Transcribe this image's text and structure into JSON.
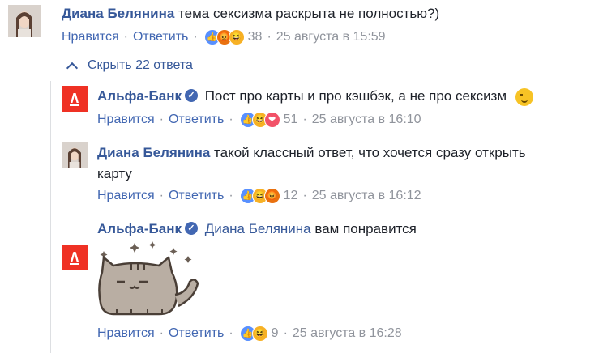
{
  "colors": {
    "link": "#365899",
    "action": "#4267b2",
    "meta": "#90949c",
    "alfa_red": "#ef3124"
  },
  "toggle": {
    "label": "Скрыть 22 ответа",
    "icon": "chevron-up-icon"
  },
  "actions": {
    "like": "Нравится",
    "reply": "Ответить",
    "separator": "·"
  },
  "comments": [
    {
      "author": "Диана Белянина",
      "text": "тема сексизма раскрыта не полностью?)",
      "reactions": [
        "like",
        "laugh",
        "laugh"
      ],
      "reaction_count": "38",
      "date": "25 августа в 15:59"
    },
    {
      "author": "Альфа-Банк",
      "verified": true,
      "text": "Пост про карты и про кэшбэк, а не про сексизм",
      "emoji": "wink-emoji",
      "reactions": [
        "like",
        "laugh",
        "heart"
      ],
      "reaction_count": "51",
      "date": "25 августа в 16:10"
    },
    {
      "author": "Диана Белянина",
      "text_line1": "такой классный ответ, что хочется сразу открыть",
      "text_line2": "карту",
      "reactions": [
        "like",
        "laugh",
        "angry"
      ],
      "reaction_count": "12",
      "date": "25 августа в 16:12"
    },
    {
      "author": "Альфа-Банк",
      "verified": true,
      "mention": "Диана Белянина",
      "text": "вам понравится",
      "sticker": "pusheen-cat-sticker",
      "reactions": [
        "like",
        "laugh"
      ],
      "reaction_count": "9",
      "date": "25 августа в 16:28"
    }
  ]
}
